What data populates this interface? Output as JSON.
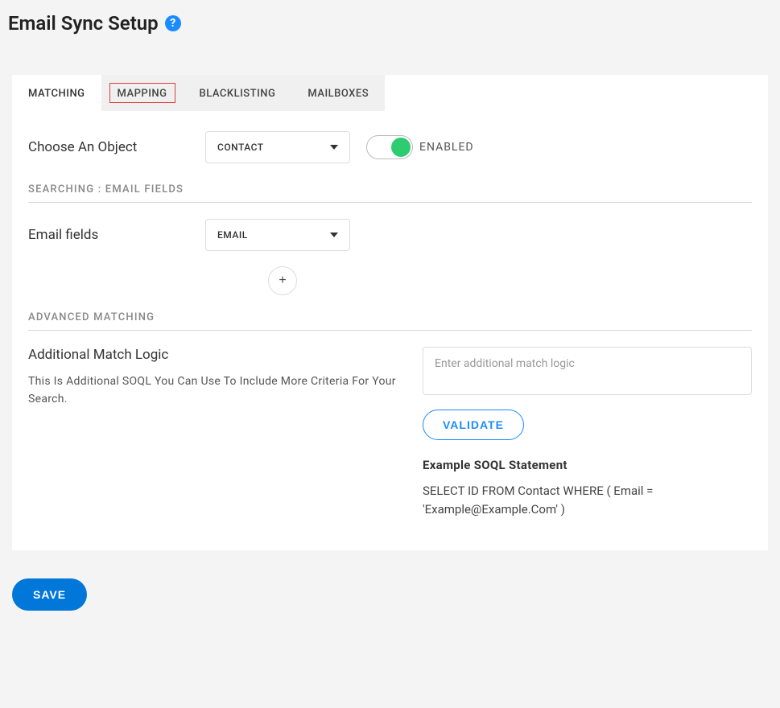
{
  "header": {
    "title": "Email Sync Setup"
  },
  "tabs": [
    {
      "label": "MATCHING",
      "active": true
    },
    {
      "label": "MAPPING",
      "highlighted": true
    },
    {
      "label": "BLACKLISTING"
    },
    {
      "label": "MAILBOXES"
    }
  ],
  "objectRow": {
    "label": "Choose An Object",
    "selectValue": "CONTACT",
    "toggleLabel": "ENABLED"
  },
  "searching": {
    "heading": "SEARCHING : EMAIL FIELDS",
    "fieldLabel": "Email fields",
    "fieldSelectValue": "EMAIL"
  },
  "advanced": {
    "heading": "ADVANCED MATCHING",
    "title": "Additional Match Logic",
    "helpText": "This Is Additional SOQL You Can Use To Include More Criteria For Your Search.",
    "placeholder": "Enter additional match logic",
    "validateLabel": "VALIDATE",
    "exampleTitle": "Example SOQL Statement",
    "exampleCode": "SELECT ID FROM Contact WHERE ( Email = 'Example@Example.Com' )"
  },
  "saveLabel": "SAVE"
}
